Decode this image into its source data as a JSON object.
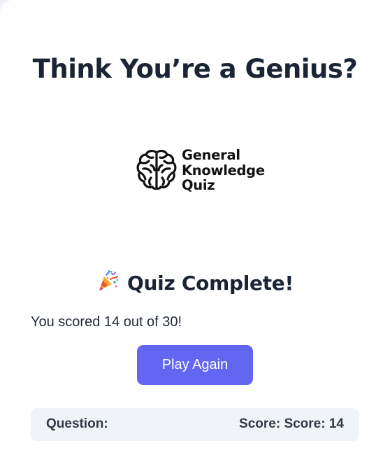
{
  "header": {
    "title": "Think You’re a Genius?"
  },
  "logo": {
    "icon": "brain-icon",
    "lines": [
      "General",
      "Knowledge",
      "Quiz"
    ]
  },
  "result": {
    "emoji_icon": "party-popper-icon",
    "heading": "Quiz Complete!",
    "score_text": "You scored 14 out of 30!",
    "play_again_label": "Play Again"
  },
  "status_bar": {
    "question_label": "Question:",
    "score_label": "Score: Score: 14"
  },
  "colors": {
    "accent": "#6366f1",
    "heading": "#1b2434",
    "status_bg": "#f0f3f7"
  }
}
